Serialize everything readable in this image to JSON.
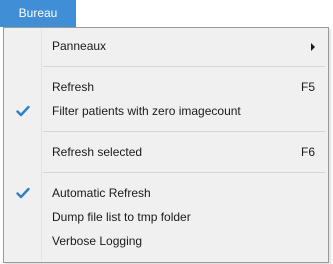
{
  "menubar": {
    "title": "Bureau"
  },
  "menu": {
    "items": [
      {
        "label": "Panneaux",
        "shortcut": "",
        "submenu": true,
        "checked": false
      },
      {
        "label": "Refresh",
        "shortcut": "F5",
        "submenu": false,
        "checked": false
      },
      {
        "label": "Filter patients with zero imagecount",
        "shortcut": "",
        "submenu": false,
        "checked": true
      },
      {
        "label": "Refresh selected",
        "shortcut": "F6",
        "submenu": false,
        "checked": false
      },
      {
        "label": "Automatic Refresh",
        "shortcut": "",
        "submenu": false,
        "checked": true
      },
      {
        "label": "Dump file list to tmp folder",
        "shortcut": "",
        "submenu": false,
        "checked": false
      },
      {
        "label": "Verbose Logging",
        "shortcut": "",
        "submenu": false,
        "checked": false
      }
    ]
  },
  "colors": {
    "menubar_highlight": "#3f8ed6",
    "check_color": "#2f7fc8",
    "menu_background": "#f0f0f0"
  },
  "icons": {
    "check": "check-icon",
    "submenu": "chevron-right-icon"
  }
}
